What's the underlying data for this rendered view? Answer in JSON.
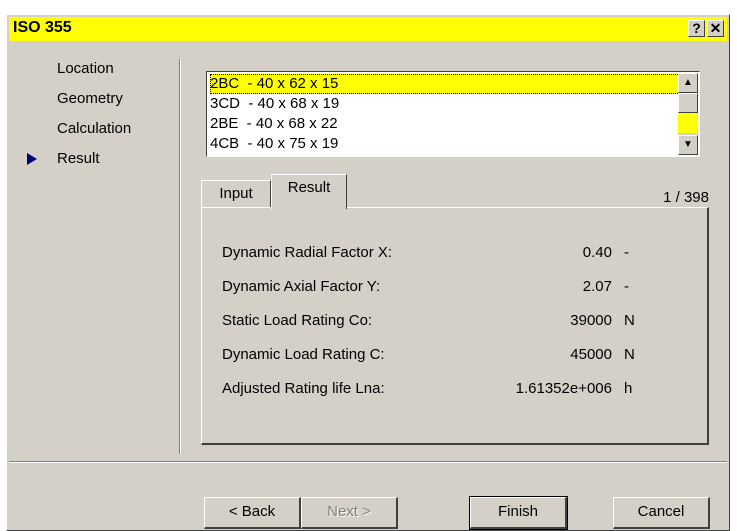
{
  "window": {
    "title": "ISO 355",
    "help_label": "?",
    "close_label": "✕"
  },
  "nav": {
    "items": [
      {
        "label": "Location"
      },
      {
        "label": "Geometry"
      },
      {
        "label": "Calculation"
      },
      {
        "label": "Result"
      }
    ],
    "active_index": 3
  },
  "list": {
    "rows": [
      {
        "label": "2BC  - 40 x 62 x 15",
        "selected": true
      },
      {
        "label": "3CD  - 40 x 68 x 19",
        "selected": false
      },
      {
        "label": "2BE  - 40 x 68 x 22",
        "selected": false
      },
      {
        "label": "4CB  - 40 x 75 x 19",
        "selected": false
      }
    ],
    "scroll_up_icon": "▲",
    "scroll_down_icon": "▼"
  },
  "tabs": {
    "input_label": "Input",
    "result_label": "Result",
    "active": "Result"
  },
  "counter": "1 / 398",
  "result": {
    "rows": [
      {
        "label": "Dynamic Radial Factor X:",
        "value": "0.40",
        "unit": "-"
      },
      {
        "label": "Dynamic Axial Factor Y:",
        "value": "2.07",
        "unit": "-"
      },
      {
        "label": "Static Load Rating Co:",
        "value": "39000",
        "unit": "N"
      },
      {
        "label": "Dynamic Load Rating C:",
        "value": "45000",
        "unit": "N"
      },
      {
        "label": "Adjusted Rating life Lna:",
        "value": "1.61352e+006",
        "unit": "h"
      }
    ]
  },
  "buttons": {
    "back": "< Back",
    "next": "Next >",
    "finish": "Finish",
    "cancel": "Cancel"
  },
  "colors": {
    "highlight": "#ffff00",
    "face": "#d4d0c8",
    "nav_arrow": "#00007f"
  }
}
